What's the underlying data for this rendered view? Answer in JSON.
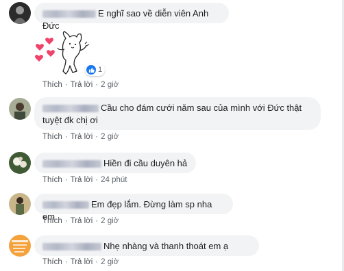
{
  "colors": {
    "bubble": "#f2f3f5",
    "action_text": "#606770",
    "like_blue": "#1877f2",
    "heart_red": "#f0436a"
  },
  "actions": {
    "like": "Thích",
    "reply": "Trả lời"
  },
  "comments": [
    {
      "text": "E nghĩ sao về diễn viên Anh Đức",
      "time": "2 giờ",
      "sticker_icon": "white-cat-hearts-sticker",
      "reaction_icon": "like-icon",
      "reaction_count": "1"
    },
    {
      "text_line1": "Cầu cho đám cưới năm sau của mình với Đức thật",
      "text_line2": "tuyệt đk chị ơi",
      "time": "2 giờ"
    },
    {
      "text": "Hiền đi cầu duyên hả",
      "time": "24 phút"
    },
    {
      "text": "Em đẹp lắm. Đừng làm sp nha em",
      "time": "2 giờ"
    },
    {
      "text": "Nhẹ nhàng và thanh thoát em ạ",
      "time": "2 giờ"
    }
  ]
}
